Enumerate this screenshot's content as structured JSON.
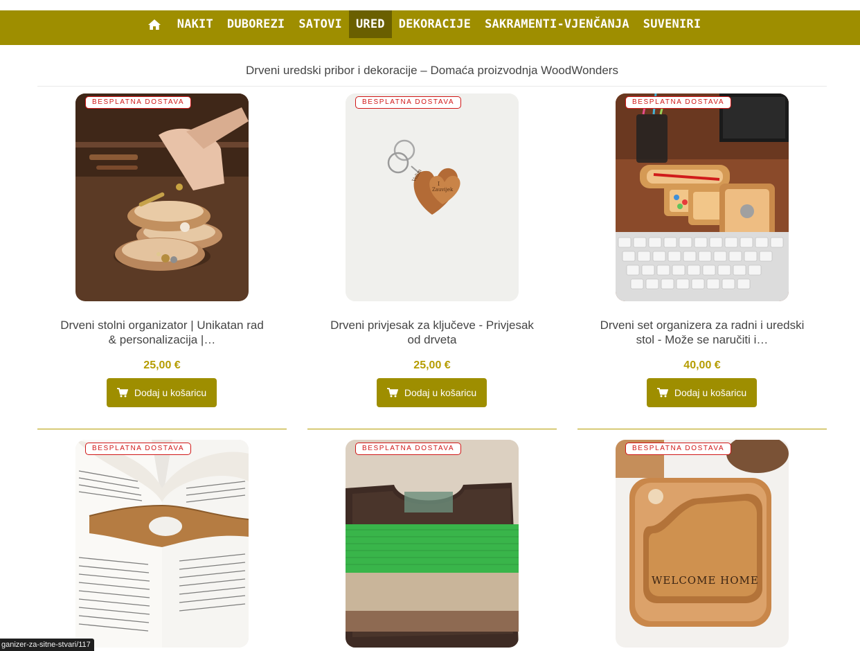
{
  "nav": {
    "home_icon": "home-icon",
    "items": [
      "NAKIT",
      "DUBOREZI",
      "SATOVI",
      "URED",
      "DEKORACIJE",
      "SAKRAMENTI-VJENČANJA",
      "SUVENIRI"
    ],
    "active": "URED"
  },
  "page": {
    "title": "Drveni uredski pribor i dekoracije – Domaća proizvodnja WoodWonders"
  },
  "products": [
    {
      "badge": "BESPLATNA DOSTAVA",
      "name": "Drveni stolni organizator | Unikatan rad & personalizacija |…",
      "price": "25,00 €",
      "button": "Dodaj u košaricu"
    },
    {
      "badge": "BESPLATNA DOSTAVA",
      "name": "Drveni privjesak za ključeve - Privjesak od drveta",
      "price": "25,00 €",
      "button": "Dodaj u košaricu"
    },
    {
      "badge": "BESPLATNA DOSTAVA",
      "name": "Drveni set organizera za radni i uredski stol - Može se naručiti i…",
      "price": "40,00 €",
      "button": "Dodaj u košaricu"
    },
    {
      "badge": "BESPLATNA DOSTAVA"
    },
    {
      "badge": "BESPLATNA DOSTAVA"
    },
    {
      "badge": "BESPLATNA DOSTAVA"
    }
  ],
  "status_url": "ganizer-za-sitne-stvari/117",
  "colors": {
    "accent": "#9e8e00",
    "active_nav": "#6a5f00",
    "price": "#b59c00",
    "badge": "#d01616"
  }
}
